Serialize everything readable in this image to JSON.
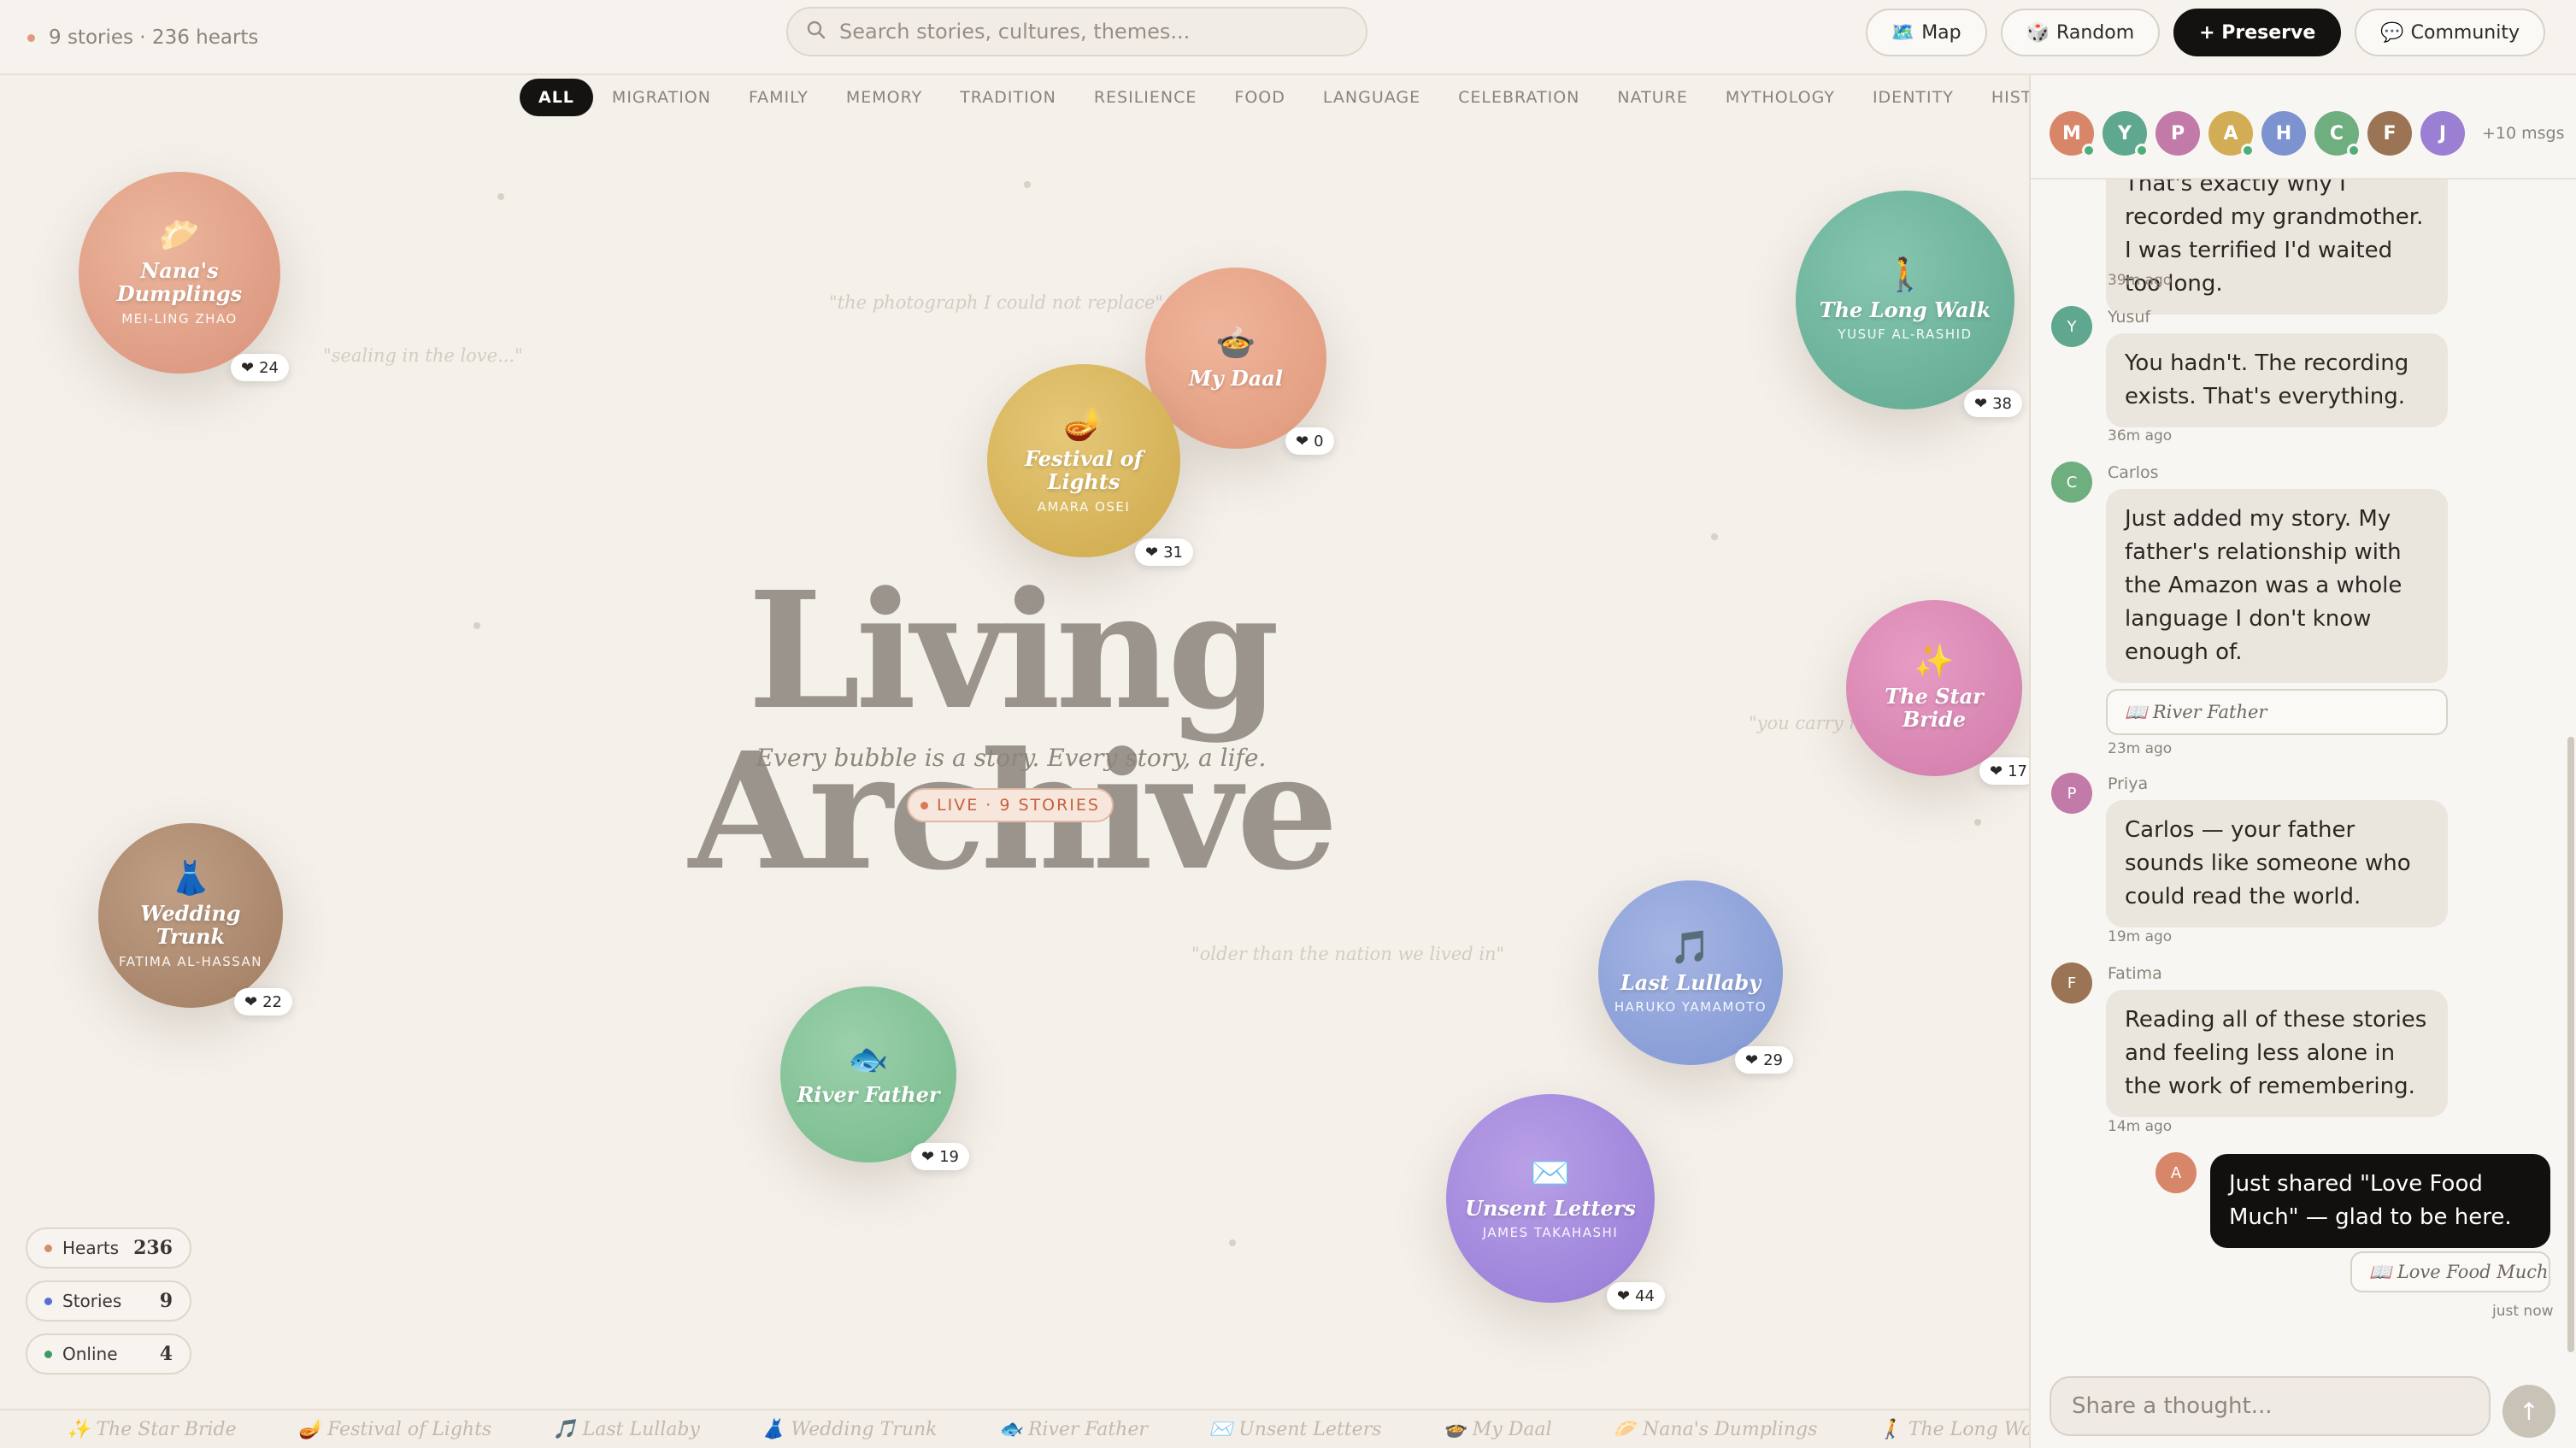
{
  "header": {
    "stories_text": "9 stories · 236 hearts",
    "search_placeholder": "Search stories, cultures, themes...",
    "buttons": {
      "map": "Map",
      "random": "Random",
      "preserve": "+ Preserve",
      "community": "Community"
    }
  },
  "tabs": [
    "ALL",
    "MIGRATION",
    "FAMILY",
    "MEMORY",
    "TRADITION",
    "RESILIENCE",
    "FOOD",
    "LANGUAGE",
    "CELEBRATION",
    "NATURE",
    "MYTHOLOGY",
    "IDENTITY",
    "HISTORY"
  ],
  "hero": {
    "title": "Living Archive",
    "subtitle": "Every bubble is a story. Every story, a life.",
    "live": "LIVE · 9 STORIES"
  },
  "quotes": [
    "\"the photograph I could not replace\"",
    "\"sealing in the love...\"",
    "\"you carry more than light\"",
    "\"older than the nation we lived in\""
  ],
  "bubbles": [
    {
      "title": "Nana's Dumplings",
      "author": "MEI-LING ZHAO",
      "hearts": "24",
      "icon": "dumpling-emoji",
      "glyph": "🥟",
      "color": "#e2a084"
    },
    {
      "title": "My Daal",
      "author": "",
      "hearts": "0",
      "icon": "bowl-emoji",
      "glyph": "🍲",
      "color": "#e6a083"
    },
    {
      "title": "Festival of Lights",
      "author": "AMARA OSEI",
      "hearts": "31",
      "icon": "diya-lamp-emoji",
      "glyph": "🪔",
      "color": "#d8b75c"
    },
    {
      "title": "The Long Walk",
      "author": "YUSUF AL-RASHID",
      "hearts": "38",
      "icon": "walking-person-emoji",
      "glyph": "🚶",
      "color": "#6fb39e"
    },
    {
      "title": "The Star Bride",
      "author": "",
      "hearts": "17",
      "icon": "sparkles-emoji",
      "glyph": "✨",
      "color": "#d97fb0"
    },
    {
      "title": "Wedding Trunk",
      "author": "FATIMA AL-HASSAN",
      "hearts": "22",
      "icon": "dress-emoji",
      "glyph": "👗",
      "color": "#b08a6e"
    },
    {
      "title": "River Father",
      "author": "",
      "hearts": "19",
      "icon": "fish-emoji",
      "glyph": "🐟",
      "color": "#82c197"
    },
    {
      "title": "Last Lullaby",
      "author": "HARUKO YAMAMOTO",
      "hearts": "29",
      "icon": "music-note-emoji",
      "glyph": "🎵",
      "color": "#8fa3db"
    },
    {
      "title": "Unsent Letters",
      "author": "JAMES TAKAHASHI",
      "hearts": "44",
      "icon": "envelope-emoji",
      "glyph": "✉️",
      "color": "#a689dd"
    }
  ],
  "stats": [
    {
      "label": "Hearts",
      "value": "236",
      "color": "#d98a6a"
    },
    {
      "label": "Stories",
      "value": "9",
      "color": "#5c6bd6"
    },
    {
      "label": "Online",
      "value": "4",
      "color": "#3f9a62"
    }
  ],
  "ticker": [
    "✨ The Star Bride",
    "🪔 Festival of Lights",
    "🎵 Last Lullaby",
    "👗 Wedding Trunk",
    "🐟 River Father",
    "✉️ Unsent Letters",
    "🍲 My Daal",
    "🥟 Nana's Dumplings",
    "🚶 The Long Walk"
  ],
  "sidebar": {
    "avatars": [
      {
        "initial": "M",
        "color": "#d8866a",
        "online": true
      },
      {
        "initial": "Y",
        "color": "#5fa78f",
        "online": true
      },
      {
        "initial": "P",
        "color": "#c27aa8",
        "online": false
      },
      {
        "initial": "A",
        "color": "#d2ad55",
        "online": true
      },
      {
        "initial": "H",
        "color": "#7d93d0",
        "online": false
      },
      {
        "initial": "C",
        "color": "#6fae7f",
        "online": true
      },
      {
        "initial": "F",
        "color": "#9a7455",
        "online": false
      },
      {
        "initial": "J",
        "color": "#9a7fd2",
        "online": false
      }
    ],
    "more_msgs": "+10 msgs",
    "messages": [
      {
        "name": "",
        "initial": "",
        "color": "",
        "text": "That's exactly why I recorded my grandmother. I was terrified I'd waited too long.",
        "time": "39m ago",
        "link": ""
      },
      {
        "name": "Yusuf",
        "initial": "Y",
        "color": "#5fa78f",
        "text": "You hadn't. The recording exists. That's everything.",
        "time": "36m ago",
        "link": ""
      },
      {
        "name": "Carlos",
        "initial": "C",
        "color": "#6fae7f",
        "text": "Just added my story. My father's relationship with the Amazon was a whole language I don't know enough of.",
        "time": "23m ago",
        "link": "📖 River Father"
      },
      {
        "name": "Priya",
        "initial": "P",
        "color": "#c27aa8",
        "text": "Carlos — your father sounds like someone who could read the world.",
        "time": "19m ago",
        "link": ""
      },
      {
        "name": "Fatima",
        "initial": "F",
        "color": "#9a7455",
        "text": "Reading all of these stories and feeling less alone in the work of remembering.",
        "time": "14m ago",
        "link": ""
      }
    ],
    "mine": {
      "initial": "A",
      "color": "#d8866a",
      "text": "Just shared \"Love Food Much\" — glad to be here.",
      "link": "📖 Love Food Much",
      "time": "just now"
    },
    "compose_placeholder": "Share a thought..."
  }
}
